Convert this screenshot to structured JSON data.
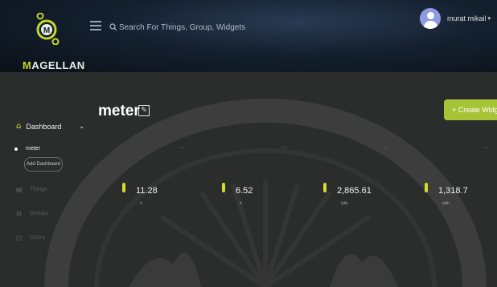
{
  "brand": {
    "name": "MAGELLAN",
    "accent_letter": "M",
    "rest": "AGELLAN"
  },
  "search": {
    "placeholder": "Search For Things, Group, Widgets"
  },
  "user": {
    "name": "murat mikail",
    "caret": "▾"
  },
  "page": {
    "title": "meter",
    "create_widget_label": "+ Create Widget"
  },
  "sidebar": {
    "dashboard_label": "Dashboard",
    "dashboard_chevron": "⌄",
    "active_dashboard": "meter",
    "add_dashboard_label": "Add Dashboard",
    "items": [
      {
        "label": "Things",
        "icon": "things-icon",
        "glyph": "▤"
      },
      {
        "label": "Groups",
        "icon": "groups-icon",
        "glyph": "⊟"
      },
      {
        "label": "Users",
        "icon": "users-icon",
        "glyph": "◫"
      }
    ]
  },
  "widgets": [
    {
      "value": "11.28",
      "unit": "V"
    },
    {
      "value": "6.52",
      "unit": "A"
    },
    {
      "value": "2,865.61",
      "unit": "kWh"
    },
    {
      "value": "1,318.7",
      "unit": "kWh"
    }
  ],
  "widget_menu_glyph": "···",
  "colors": {
    "accent": "#a7c437",
    "bar": "#d6dc2a",
    "topbar": "#0b1018",
    "background": "#2b2c2c"
  }
}
